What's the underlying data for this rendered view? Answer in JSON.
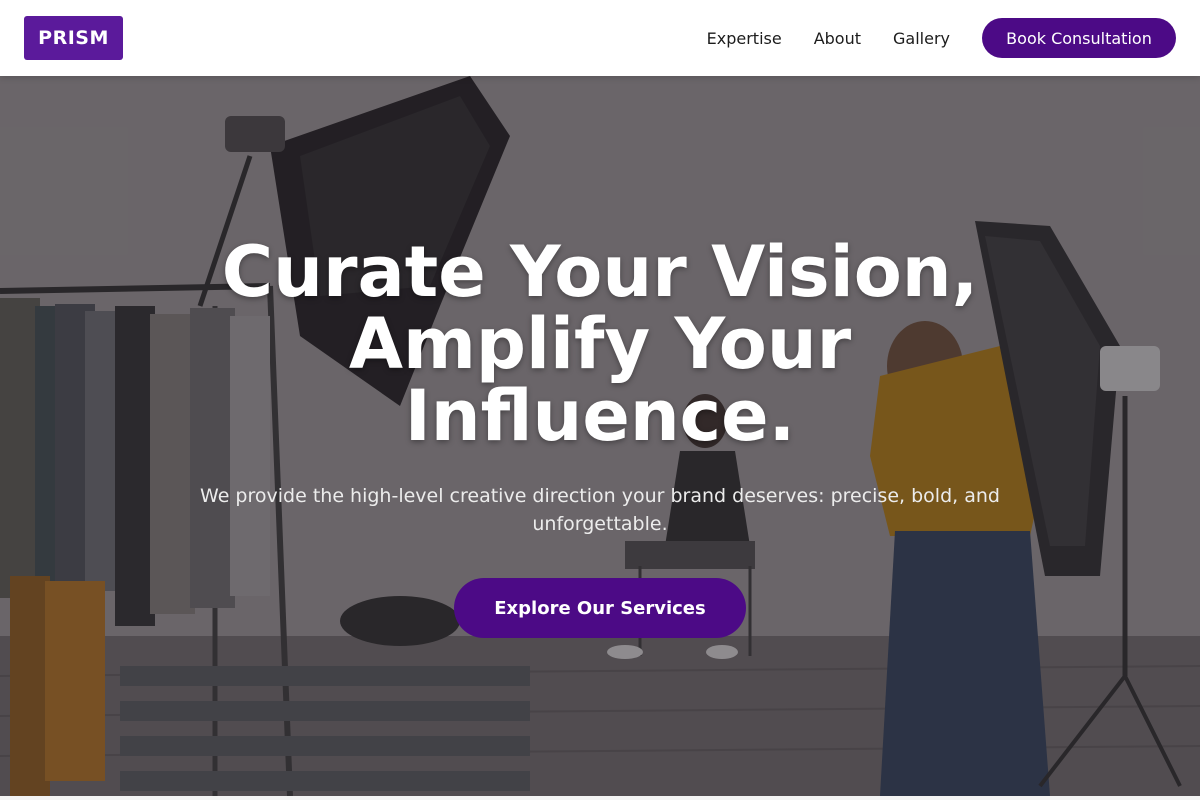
{
  "brand": {
    "logo_text": "PRISM",
    "accent_color": "#4c0a86"
  },
  "nav": {
    "links": [
      "Expertise",
      "About",
      "Gallery"
    ],
    "cta_label": "Book Consultation"
  },
  "hero": {
    "headline": "Curate Your Vision, Amplify Your Influence.",
    "subheadline": "We provide the high-level creative direction your brand deserves: precise, bold, and unforgettable.",
    "cta_label": "Explore Our Services",
    "background_image": "photo-studio-shoot"
  }
}
